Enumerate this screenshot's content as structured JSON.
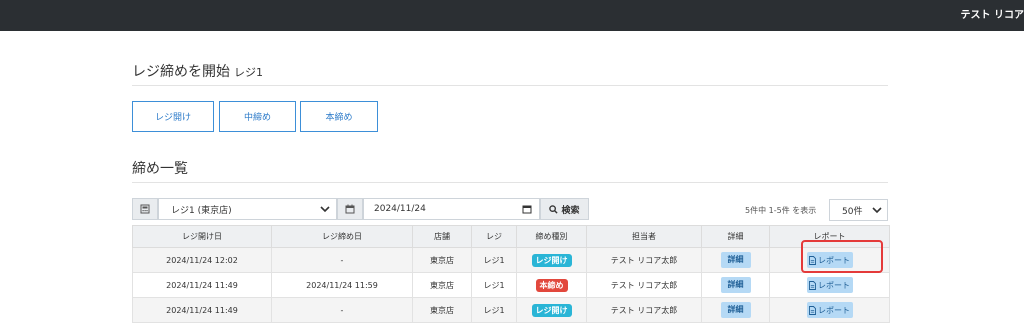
{
  "header": {
    "user_name": "テスト リコア"
  },
  "page": {
    "title": "レジ締めを開始",
    "register": "レジ1"
  },
  "actions": {
    "open_label": "レジ開け",
    "mid_label": "中締め",
    "close_label": "本締め"
  },
  "section": {
    "title": "締め一覧"
  },
  "filters": {
    "register_icon": "register-icon",
    "register_value": "レジ1 (東京店)",
    "calendar_icon": "calendar-icon",
    "date_value": "2024/11/24",
    "search_label": "検索"
  },
  "pagination": {
    "count_text": "5件中 1-5件 を表示",
    "per_page": "50件"
  },
  "table": {
    "headers": [
      "レジ開け日",
      "レジ締め日",
      "店舗",
      "レジ",
      "締め種別",
      "担当者",
      "詳細",
      "レポート"
    ],
    "detail_label": "詳細",
    "report_label": "レポート",
    "rows": [
      {
        "open_date": "2024/11/24 12:02",
        "close_date": "-",
        "store": "東京店",
        "register": "レジ1",
        "type": "レジ開け",
        "type_color": "#2ab5d6",
        "staff": "テスト リコア太郎"
      },
      {
        "open_date": "2024/11/24 11:49",
        "close_date": "2024/11/24 11:59",
        "store": "東京店",
        "register": "レジ1",
        "type": "本締め",
        "type_color": "#e2483d",
        "staff": "テスト リコア太郎"
      },
      {
        "open_date": "2024/11/24 11:49",
        "close_date": "-",
        "store": "東京店",
        "register": "レジ1",
        "type": "レジ開け",
        "type_color": "#2ab5d6",
        "staff": "テスト リコア太郎"
      }
    ]
  },
  "colors": {
    "topbar": "#2b2f33",
    "primary": "#3d8fd8",
    "highlight": "#e43a3a"
  }
}
